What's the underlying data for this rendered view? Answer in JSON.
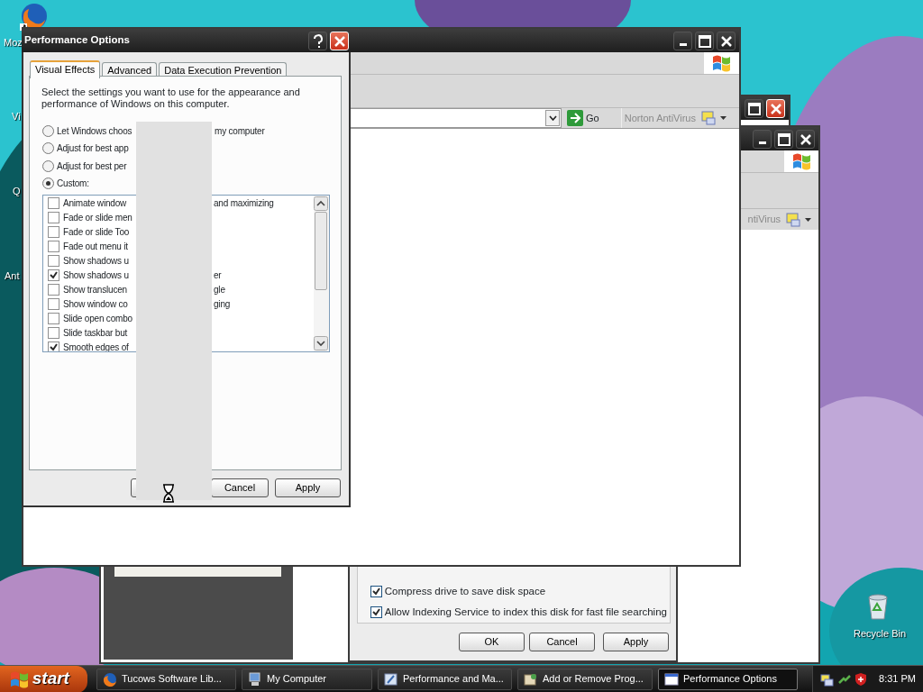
{
  "desktop_icons": [
    {
      "label": "Moz"
    },
    {
      "label": "Vi"
    },
    {
      "label": "Q"
    },
    {
      "label": "Ant"
    },
    {
      "label": "Recycle Bin"
    }
  ],
  "right_window": {
    "toolbar_label": "ntiVirus"
  },
  "drive_properties": {
    "options": [
      {
        "label": "Compress drive to save disk space",
        "checked": true
      },
      {
        "label": "Allow Indexing Service to index this disk for fast file searching",
        "checked": true
      }
    ],
    "buttons": [
      "OK",
      "Cancel",
      "Apply"
    ]
  },
  "browser_window": {
    "go": "Go",
    "toolbar_label": "Norton AntiVirus"
  },
  "performance_options": {
    "title": "Performance Options",
    "tabs": [
      {
        "label": "Visual Effects",
        "selected": true
      },
      {
        "label": "Advanced",
        "selected": false
      },
      {
        "label": "Data Execution Prevention",
        "selected": false
      }
    ],
    "description": "Select the settings you want to use for the appearance and performance of Windows on this computer.",
    "radios": [
      {
        "label": "Let Windows choos",
        "label_right": "my computer",
        "selected": false
      },
      {
        "label": "Adjust for best app",
        "selected": false
      },
      {
        "label": "Adjust for best per",
        "selected": false
      },
      {
        "label": "Custom:",
        "selected": true
      }
    ],
    "effects": [
      {
        "label": "Animate window",
        "label_right": "and maximizing",
        "checked": false
      },
      {
        "label": "Fade or slide men",
        "checked": false
      },
      {
        "label": "Fade or slide Too",
        "checked": false
      },
      {
        "label": "Fade out menu it",
        "checked": false
      },
      {
        "label": "Show shadows u",
        "checked": false
      },
      {
        "label": "Show shadows u",
        "label_right": "er",
        "checked": true
      },
      {
        "label": "Show translucen",
        "label_right": "gle",
        "checked": false
      },
      {
        "label": "Show window co",
        "label_right": "ging",
        "checked": false
      },
      {
        "label": "Slide open combo",
        "checked": false
      },
      {
        "label": "Slide taskbar but",
        "checked": false
      },
      {
        "label": "Smooth edges of",
        "checked": true
      }
    ],
    "buttons": [
      "Cancel",
      "Apply"
    ]
  },
  "taskbar": {
    "start": "start",
    "tasks": [
      {
        "label": "Tucows Software Lib...",
        "selected": false,
        "kind": "browser"
      },
      {
        "label": "My Computer",
        "selected": false,
        "kind": "computer"
      },
      {
        "label": "Performance and Ma...",
        "selected": false,
        "kind": "panel"
      },
      {
        "label": "Add or Remove Prog...",
        "selected": false,
        "kind": "installer"
      },
      {
        "label": "Performance Options",
        "selected": true,
        "kind": "window"
      }
    ],
    "clock": "8:31 PM"
  }
}
